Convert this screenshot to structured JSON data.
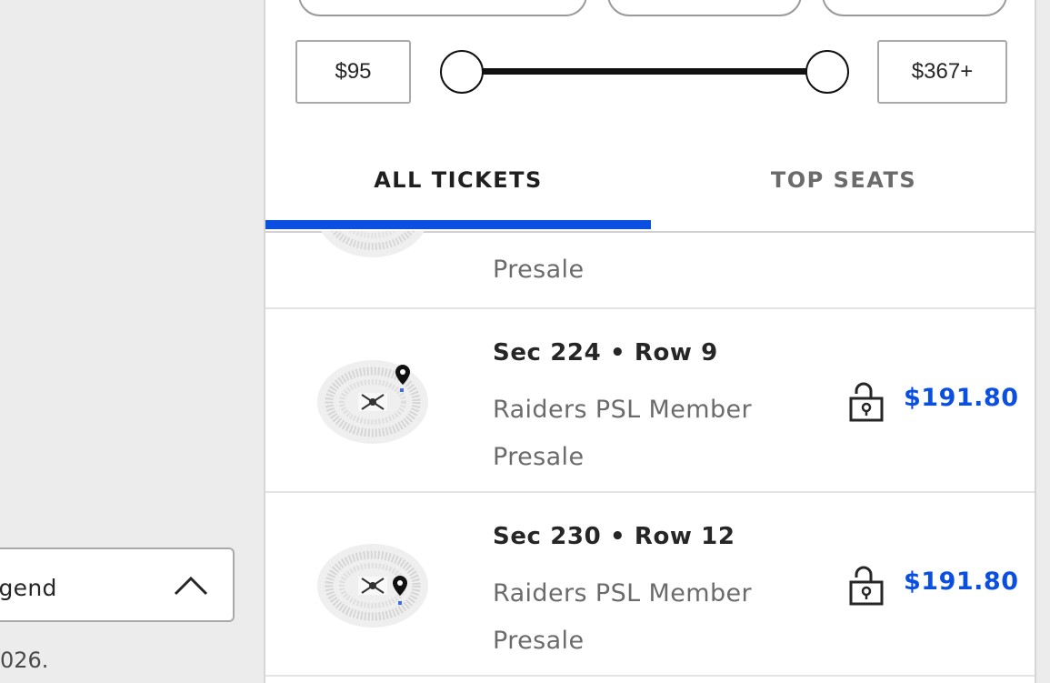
{
  "map": {
    "legend_label": "Legend",
    "footer_text": "026."
  },
  "filters": {
    "price_min": "$95",
    "price_max": "$367+",
    "range_fraction": [
      0.0,
      1.0
    ]
  },
  "tabs": [
    {
      "label": "ALL TICKETS",
      "active": true
    },
    {
      "label": "TOP SEATS",
      "active": false
    }
  ],
  "tickets": {
    "partial_desc_line2": "Presale",
    "items": [
      {
        "section_row": "Sec 224 • Row 9",
        "desc_line1": "Raiders PSL Member",
        "desc_line2": "Presale",
        "price": "$191.80",
        "icon": "unlocked-padlock-icon"
      },
      {
        "section_row": "Sec 230 • Row 12",
        "desc_line1": "Raiders PSL Member",
        "desc_line2": "Presale",
        "price": "$191.80",
        "icon": "unlocked-padlock-icon"
      }
    ]
  },
  "colors": {
    "accent": "#0a4fe0",
    "text": "#262626",
    "muted": "#6b6b6b"
  }
}
